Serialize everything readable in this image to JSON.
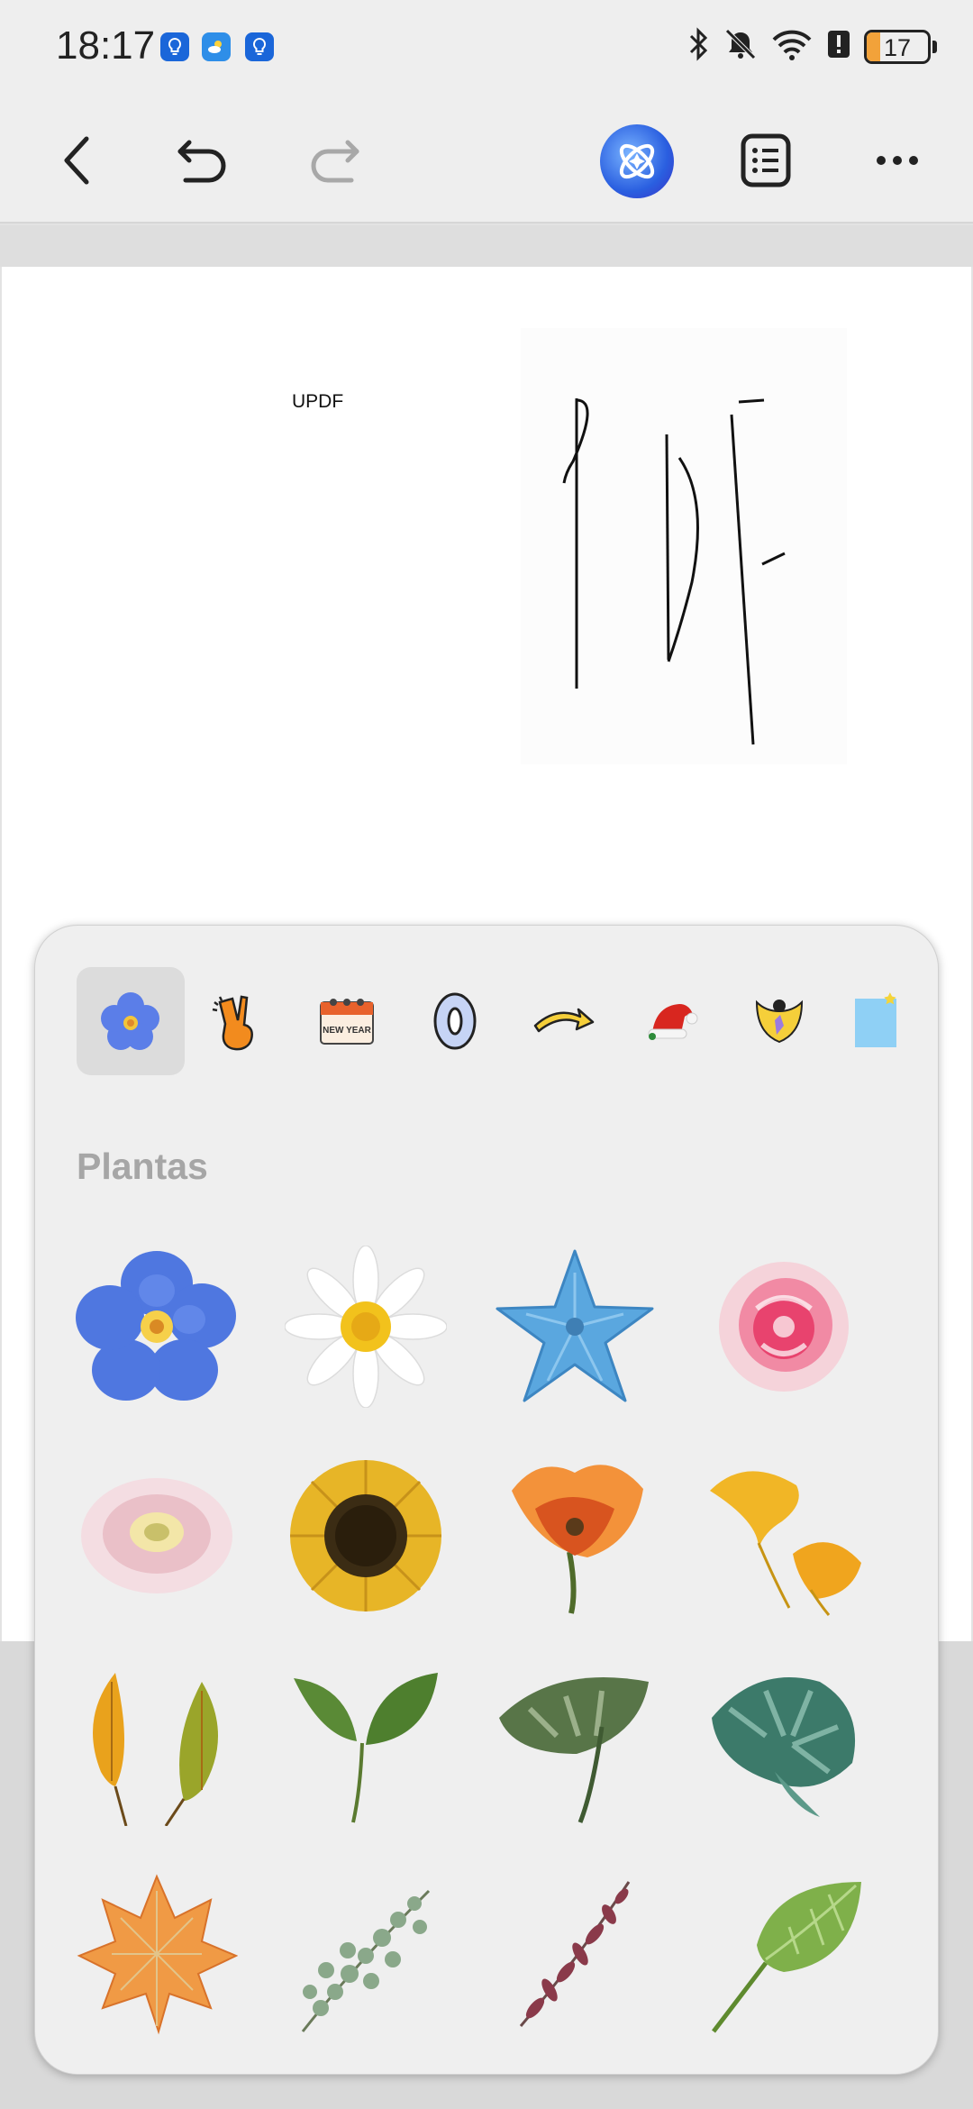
{
  "status_bar": {
    "time": "18:17",
    "battery": "17",
    "icons": [
      "bulb-app-icon",
      "weather-app-icon",
      "bulb-app-icon",
      "bluetooth-icon",
      "bell-muted-icon",
      "wifi-icon",
      "alert-icon",
      "battery-icon"
    ]
  },
  "toolbar": {
    "icons": [
      "back-arrow-icon",
      "undo-icon",
      "redo-icon",
      "ai-assistant-icon",
      "outline-list-icon",
      "more-icon"
    ]
  },
  "document": {
    "text": "UPDF",
    "colors": {
      "page": "#ffffff",
      "ink": "#111111"
    }
  },
  "sticker_panel": {
    "categories": [
      "flower-category-icon",
      "peace-hand-category-icon",
      "new-year-calendar-category-icon",
      "number-zero-category-icon",
      "arrow-category-icon",
      "santa-hat-category-icon",
      "character-category-icon",
      "sticky-note-category-icon"
    ],
    "calendar_label": "NEW YEAR",
    "section_title": "Plantas",
    "stickers": [
      "blue-forget-me-not",
      "white-daisy",
      "blue-star-flower",
      "pink-rose",
      "pink-gerbera",
      "sunflower",
      "orange-poppy",
      "ginkgo-leaves",
      "autumn-leaves",
      "green-sprout",
      "monstera-leaf",
      "monstera-plant",
      "maple-leaf",
      "eucalyptus-sprig",
      "red-berry-sprig",
      "hosta-leaf"
    ],
    "colors": {
      "panel": "#efefef",
      "title": "#a6a6a6",
      "active": "#dcdcdc"
    }
  }
}
